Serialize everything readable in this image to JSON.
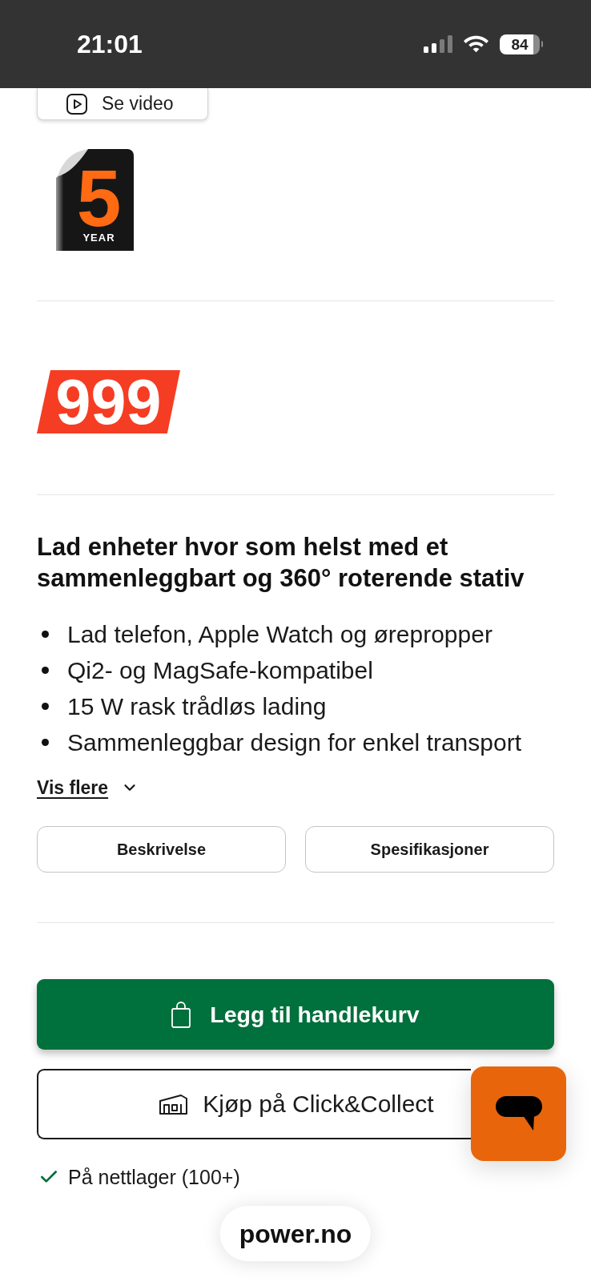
{
  "status_bar": {
    "time": "21:01",
    "battery": "84"
  },
  "video_button": {
    "label": "Se video"
  },
  "warranty_badge": {
    "number": "5",
    "label": "YEAR"
  },
  "price": "999",
  "title": "Lad enheter hvor som helst med et sammenleggbart og 360° roterende stativ",
  "highlights": [
    "Lad telefon, Apple Watch og ørepropper",
    "Qi2- og MagSafe-kompatibel",
    "15 W rask trådløs lading",
    "Sammenleggbar design for enkel transport"
  ],
  "show_more": {
    "label": "Vis flere",
    "expanded": false
  },
  "info_buttons": [
    {
      "label": "Beskrivelse"
    },
    {
      "label": "Spesifikasjoner"
    }
  ],
  "add_to_cart": {
    "label": "Legg til handlekurv"
  },
  "click_and_collect": {
    "label": "Kjøp på Click&Collect"
  },
  "stock": {
    "label": "På nettlager (100+)",
    "in_stock": true
  },
  "browser_bar": {
    "url": "power.no"
  }
}
